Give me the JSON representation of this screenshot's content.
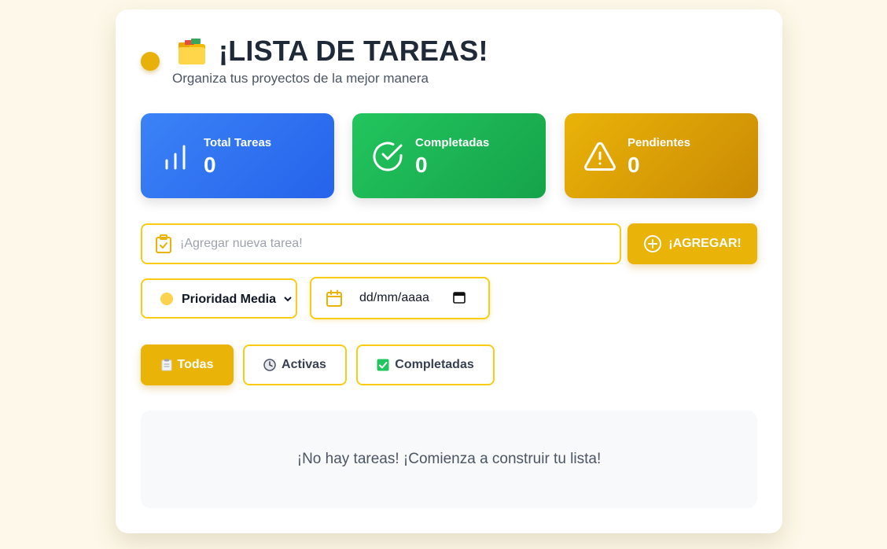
{
  "header": {
    "title": "¡LISTA DE TAREAS!",
    "subtitle": "Organiza tus proyectos de la mejor manera",
    "icon": "folder-icon",
    "accent": "#e8b10a"
  },
  "stats": [
    {
      "label": "Total Tareas",
      "value": "0",
      "icon": "bar-chart-icon",
      "color": "#3b82f6"
    },
    {
      "label": "Completadas",
      "value": "0",
      "icon": "check-circle-icon",
      "color": "#22c55e"
    },
    {
      "label": "Pendientes",
      "value": "0",
      "icon": "warning-icon",
      "color": "#eab308"
    }
  ],
  "new_task": {
    "placeholder": "¡Agregar nueva tarea!",
    "value": "",
    "add_label": "¡AGREGAR!"
  },
  "priority": {
    "selected": "Prioridad Media",
    "dot_color": "#fcd34d"
  },
  "due_date": {
    "value": "dd/mm/aaaa"
  },
  "filters": [
    {
      "label": "Todas",
      "icon": "clipboard-icon",
      "active": true
    },
    {
      "label": "Activas",
      "icon": "clock-icon",
      "active": false
    },
    {
      "label": "Completadas",
      "icon": "checkbox-icon",
      "active": false
    }
  ],
  "empty_state": {
    "message": "¡No hay tareas! ¡Comienza a construir tu lista!"
  }
}
